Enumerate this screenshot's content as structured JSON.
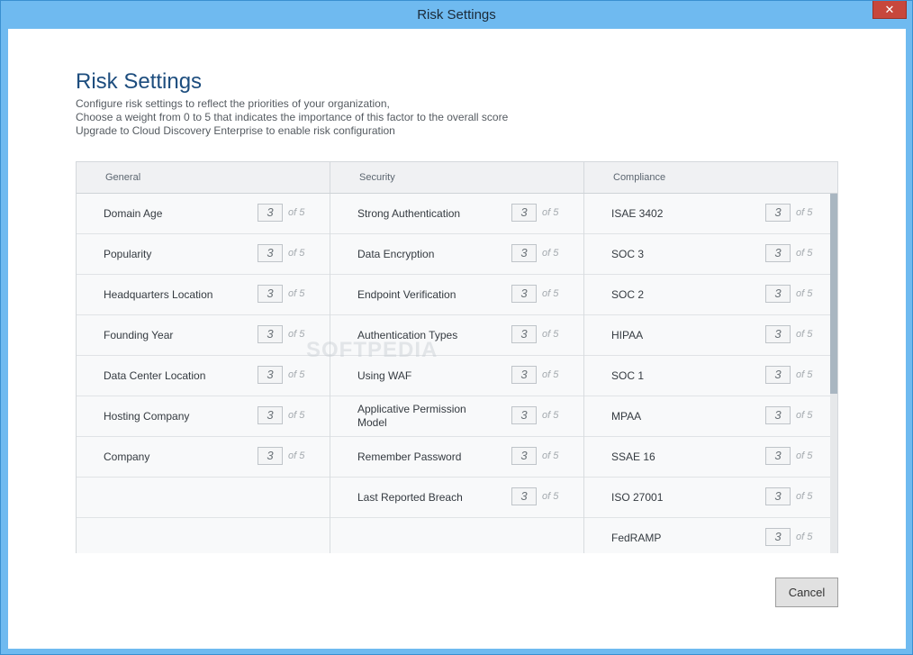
{
  "window": {
    "title": "Risk Settings",
    "close_label": "✕"
  },
  "header": {
    "title": "Risk Settings",
    "lines": [
      "Configure risk settings to reflect the priorities of your organization,",
      "Choose a weight from 0 to 5 that indicates the importance of this factor to the overall score",
      "Upgrade to Cloud Discovery Enterprise to enable risk configuration"
    ]
  },
  "columns": [
    {
      "header": "General",
      "rows": [
        {
          "label": "Domain Age",
          "value": "3"
        },
        {
          "label": "Popularity",
          "value": "3"
        },
        {
          "label": "Headquarters Location",
          "value": "3"
        },
        {
          "label": "Founding Year",
          "value": "3"
        },
        {
          "label": "Data Center Location",
          "value": "3"
        },
        {
          "label": "Hosting Company",
          "value": "3"
        },
        {
          "label": "Company",
          "value": "3"
        }
      ]
    },
    {
      "header": "Security",
      "rows": [
        {
          "label": "Strong Authentication",
          "value": "3"
        },
        {
          "label": "Data Encryption",
          "value": "3"
        },
        {
          "label": "Endpoint Verification",
          "value": "3"
        },
        {
          "label": "Authentication Types",
          "value": "3"
        },
        {
          "label": "Using WAF",
          "value": "3"
        },
        {
          "label": "Applicative Permission Model",
          "value": "3"
        },
        {
          "label": "Remember Password",
          "value": "3"
        },
        {
          "label": "Last Reported Breach",
          "value": "3"
        }
      ]
    },
    {
      "header": "Compliance",
      "rows": [
        {
          "label": "ISAE 3402",
          "value": "3"
        },
        {
          "label": "SOC 3",
          "value": "3"
        },
        {
          "label": "SOC 2",
          "value": "3"
        },
        {
          "label": "HIPAA",
          "value": "3"
        },
        {
          "label": "SOC 1",
          "value": "3"
        },
        {
          "label": "MPAA",
          "value": "3"
        },
        {
          "label": "SSAE 16",
          "value": "3"
        },
        {
          "label": "ISO 27001",
          "value": "3"
        },
        {
          "label": "FedRAMP",
          "value": "3"
        }
      ]
    }
  ],
  "of_label": "of 5",
  "footer": {
    "cancel_label": "Cancel"
  },
  "watermark": "SOFTPEDIA"
}
